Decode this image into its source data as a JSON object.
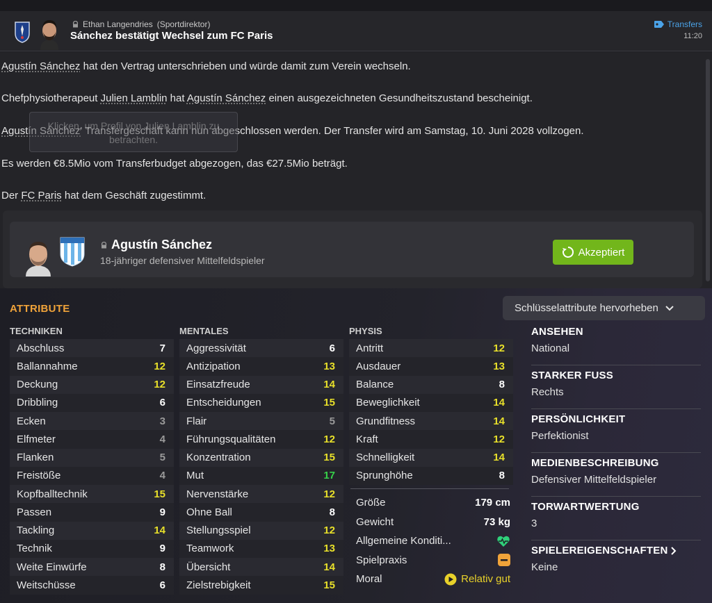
{
  "header": {
    "sender_name": "Ethan Langendries",
    "sender_role": "(Sportdirektor)",
    "title": "Sánchez bestätigt Wechsel zum FC Paris",
    "category": "Transfers",
    "time": "11:20"
  },
  "message": {
    "p1_player": "Agustín Sánchez",
    "p1_rest": " hat den Vertrag unterschrieben und würde damit zum Verein wechseln.",
    "p2_pre": "Chefphysiotherapeut ",
    "p2_physio": "Julien Lamblin",
    "p2_mid": " hat ",
    "p2_player": "Agustín Sánchez",
    "p2_rest": " einen ausgezeichneten Gesundheitszustand bescheinigt.",
    "p3_player": "Agustín Sánchez'",
    "p3_rest": " Transfergeschäft kann nun abgeschlossen werden. Der Transfer wird am Samstag, 10. Juni 2028 vollzogen.",
    "p4": "Es werden €8.5Mio vom Transferbudget abgezogen, das €27.5Mio beträgt.",
    "p5_pre": "Der ",
    "p5_club": "FC Paris",
    "p5_rest": " hat dem Geschäft zugestimmt.",
    "tooltip": "Klicken, um Profil von Julien Lamblin zu betrachten."
  },
  "player_card": {
    "name": "Agustín Sánchez",
    "subtitle": "18-jähriger defensiver Mittelfeldspieler",
    "status_button": "Akzeptiert"
  },
  "attributes": {
    "title": "ATTRIBUTE",
    "highlight_button": "Schlüsselattribute hervorheben",
    "technical_header": "TECHNIKEN",
    "mental_header": "MENTALES",
    "physical_header": "PHYSIS",
    "technical": [
      {
        "name": "Abschluss",
        "value": "7",
        "tier": "white"
      },
      {
        "name": "Ballannahme",
        "value": "12",
        "tier": "yellow"
      },
      {
        "name": "Deckung",
        "value": "12",
        "tier": "yellow"
      },
      {
        "name": "Dribbling",
        "value": "6",
        "tier": "white"
      },
      {
        "name": "Ecken",
        "value": "3",
        "tier": "grey"
      },
      {
        "name": "Elfmeter",
        "value": "4",
        "tier": "grey"
      },
      {
        "name": "Flanken",
        "value": "5",
        "tier": "grey"
      },
      {
        "name": "Freistöße",
        "value": "4",
        "tier": "grey"
      },
      {
        "name": "Kopfballtechnik",
        "value": "15",
        "tier": "yellow"
      },
      {
        "name": "Passen",
        "value": "9",
        "tier": "white"
      },
      {
        "name": "Tackling",
        "value": "14",
        "tier": "yellow"
      },
      {
        "name": "Technik",
        "value": "9",
        "tier": "white"
      },
      {
        "name": "Weite Einwürfe",
        "value": "8",
        "tier": "white"
      },
      {
        "name": "Weitschüsse",
        "value": "6",
        "tier": "white"
      }
    ],
    "mental": [
      {
        "name": "Aggressivität",
        "value": "6",
        "tier": "white"
      },
      {
        "name": "Antizipation",
        "value": "13",
        "tier": "yellow"
      },
      {
        "name": "Einsatzfreude",
        "value": "14",
        "tier": "yellow"
      },
      {
        "name": "Entscheidungen",
        "value": "15",
        "tier": "yellow"
      },
      {
        "name": "Flair",
        "value": "5",
        "tier": "grey"
      },
      {
        "name": "Führungsqualitäten",
        "value": "12",
        "tier": "yellow"
      },
      {
        "name": "Konzentration",
        "value": "15",
        "tier": "yellow"
      },
      {
        "name": "Mut",
        "value": "17",
        "tier": "green"
      },
      {
        "name": "Nervenstärke",
        "value": "12",
        "tier": "yellow"
      },
      {
        "name": "Ohne Ball",
        "value": "8",
        "tier": "white"
      },
      {
        "name": "Stellungsspiel",
        "value": "12",
        "tier": "yellow"
      },
      {
        "name": "Teamwork",
        "value": "13",
        "tier": "yellow"
      },
      {
        "name": "Übersicht",
        "value": "14",
        "tier": "yellow"
      },
      {
        "name": "Zielstrebigkeit",
        "value": "15",
        "tier": "yellow"
      }
    ],
    "physical": [
      {
        "name": "Antritt",
        "value": "12",
        "tier": "yellow"
      },
      {
        "name": "Ausdauer",
        "value": "13",
        "tier": "yellow"
      },
      {
        "name": "Balance",
        "value": "8",
        "tier": "white"
      },
      {
        "name": "Beweglichkeit",
        "value": "14",
        "tier": "yellow"
      },
      {
        "name": "Grundfitness",
        "value": "14",
        "tier": "yellow"
      },
      {
        "name": "Kraft",
        "value": "12",
        "tier": "yellow"
      },
      {
        "name": "Schnelligkeit",
        "value": "14",
        "tier": "yellow"
      },
      {
        "name": "Sprunghöhe",
        "value": "8",
        "tier": "white"
      }
    ],
    "extra": {
      "height_label": "Größe",
      "height_value": "179 cm",
      "weight_label": "Gewicht",
      "weight_value": "73 kg",
      "condition_label": "Allgemeine Konditi...",
      "match_practice_label": "Spielpraxis",
      "morale_label": "Moral",
      "morale_value": "Relativ gut"
    }
  },
  "info": [
    {
      "label": "ANSEHEN",
      "value": "National"
    },
    {
      "label": "STARKER FUSS",
      "value": "Rechts"
    },
    {
      "label": "PERSÖNLICHKEIT",
      "value": "Perfektionist"
    },
    {
      "label": "MEDIENBESCHREIBUNG",
      "value": "Defensiver Mittelfeldspieler"
    },
    {
      "label": "TORWARTWERTUNG",
      "value": "3"
    },
    {
      "label": "SPIELEREIGENSCHAFTEN",
      "value": "Keine"
    }
  ],
  "colors": {
    "accent_orange": "#f0a33a",
    "accept_green": "#72b61b",
    "link_blue": "#4ba3e8",
    "value_yellow": "#e8e02a",
    "value_green": "#36d14a"
  }
}
